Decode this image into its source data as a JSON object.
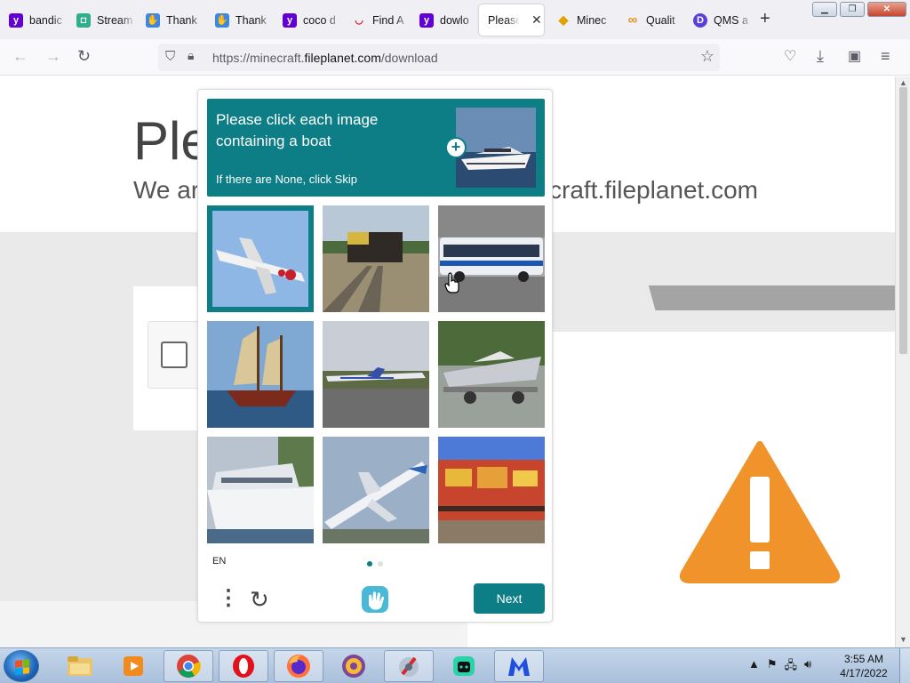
{
  "browser": {
    "tabs": [
      {
        "title": "bandic",
        "fav": "y",
        "fav_color": "#6001d2"
      },
      {
        "title": "Stream",
        "fav": "◘",
        "fav_color": "#2fae8c"
      },
      {
        "title": "Thank",
        "fav": "✋",
        "fav_color": "#3c87e0"
      },
      {
        "title": "Thank",
        "fav": "✋",
        "fav_color": "#3c87e0"
      },
      {
        "title": "coco d",
        "fav": "y",
        "fav_color": "#6001d2"
      },
      {
        "title": "Find A",
        "fav": "◡",
        "fav_color": "#ffffff"
      },
      {
        "title": "dowlo",
        "fav": "y",
        "fav_color": "#6001d2"
      },
      {
        "title": "Please V",
        "fav": "",
        "fav_color": "#ffffff"
      },
      {
        "title": "Minec",
        "fav": "◆",
        "fav_color": "#e0a100"
      },
      {
        "title": "Qualit",
        "fav": "∞",
        "fav_color": "#ffffff"
      },
      {
        "title": "QMS a",
        "fav": "D",
        "fav_color": "#5a3fd8"
      }
    ],
    "url_prefix": "https://minecraft.",
    "url_domain": "fileplanet.com",
    "url_path": "/download"
  },
  "page": {
    "title_partial": "Ple",
    "subtitle_left": "We ar",
    "subtitle_right": "craft.fileplanet.com"
  },
  "captcha": {
    "question": "Please click each image containing a boat",
    "hint": "If there are None, click Skip",
    "language": "EN",
    "next_label": "Next",
    "images": [
      {
        "name": "airplane",
        "selected": true
      },
      {
        "name": "train",
        "selected": false
      },
      {
        "name": "bus",
        "selected": false
      },
      {
        "name": "sailboat",
        "selected": false
      },
      {
        "name": "airplane-runway",
        "selected": false
      },
      {
        "name": "speedboat-trailer",
        "selected": false
      },
      {
        "name": "yacht",
        "selected": false
      },
      {
        "name": "airplane-takeoff",
        "selected": false
      },
      {
        "name": "graffiti-train",
        "selected": false
      }
    ],
    "page_dots": 2,
    "active_dot": 0
  },
  "taskbar": {
    "time": "3:55 AM",
    "date": "4/17/2022",
    "apps": [
      "explorer",
      "media-player",
      "chrome",
      "opera",
      "firefox",
      "tor-browser",
      "tool",
      "chat",
      "malwarebytes"
    ]
  },
  "colors": {
    "accent": "#0d7e86",
    "warning": "#f0932b"
  }
}
